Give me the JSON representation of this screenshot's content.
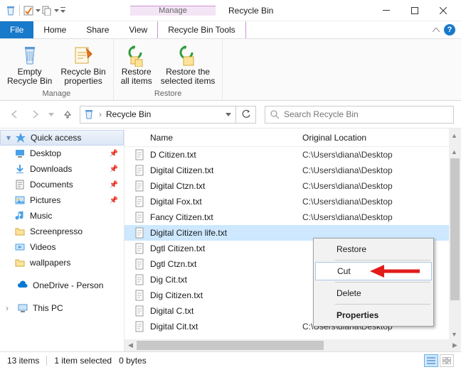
{
  "window": {
    "title": "Recycle Bin",
    "contextual_label": "Manage",
    "contextual_tab": "Recycle Bin Tools"
  },
  "tabs": {
    "file": "File",
    "home": "Home",
    "share": "Share",
    "view": "View",
    "tool": "Recycle Bin Tools"
  },
  "ribbon": {
    "group_manage": "Manage",
    "group_restore": "Restore",
    "empty": "Empty\nRecycle Bin",
    "props": "Recycle Bin\nproperties",
    "restore_all": "Restore\nall items",
    "restore_sel": "Restore the\nselected items"
  },
  "address": {
    "path": "Recycle Bin"
  },
  "search": {
    "placeholder": "Search Recycle Bin"
  },
  "sidebar": {
    "quick_access": "Quick access",
    "items": [
      {
        "label": "Desktop",
        "pinned": true,
        "icon": "desktop"
      },
      {
        "label": "Downloads",
        "pinned": true,
        "icon": "downloads"
      },
      {
        "label": "Documents",
        "pinned": true,
        "icon": "documents"
      },
      {
        "label": "Pictures",
        "pinned": true,
        "icon": "pictures"
      },
      {
        "label": "Music",
        "pinned": false,
        "icon": "music"
      },
      {
        "label": "Screenpresso",
        "pinned": false,
        "icon": "folder"
      },
      {
        "label": "Videos",
        "pinned": false,
        "icon": "videos"
      },
      {
        "label": "wallpapers",
        "pinned": false,
        "icon": "folder"
      }
    ],
    "onedrive": "OneDrive - Person",
    "thispc": "This PC"
  },
  "columns": {
    "name": "Name",
    "loc": "Original Location"
  },
  "files": [
    {
      "name": "D Citizen.txt",
      "loc": "C:\\Users\\diana\\Desktop"
    },
    {
      "name": "Digital Citizen.txt",
      "loc": "C:\\Users\\diana\\Desktop"
    },
    {
      "name": "Digital Ctzn.txt",
      "loc": "C:\\Users\\diana\\Desktop"
    },
    {
      "name": "Digital Fox.txt",
      "loc": "C:\\Users\\diana\\Desktop"
    },
    {
      "name": "Fancy Citizen.txt",
      "loc": "C:\\Users\\diana\\Desktop"
    },
    {
      "name": "Digital Citizen life.txt",
      "loc": "",
      "selected": true
    },
    {
      "name": "Dgtl Citizen.txt",
      "loc": ""
    },
    {
      "name": "Dgtl Ctzn.txt",
      "loc": ""
    },
    {
      "name": "Dig Cit.txt",
      "loc": ""
    },
    {
      "name": "Dig Citizen.txt",
      "loc": ""
    },
    {
      "name": "Digital C.txt",
      "loc": ""
    },
    {
      "name": "Digital Cit.txt",
      "loc": "C:\\Users\\diana\\Desktop"
    }
  ],
  "context_menu": {
    "restore": "Restore",
    "cut": "Cut",
    "delete": "Delete",
    "properties": "Properties"
  },
  "status": {
    "count": "13 items",
    "selected": "1 item selected",
    "size": "0 bytes"
  }
}
